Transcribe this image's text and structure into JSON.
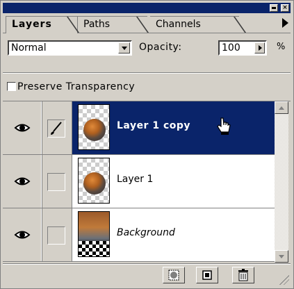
{
  "window": {
    "minimize_label": "",
    "close_label": "×"
  },
  "tabs": [
    {
      "label": "Layers",
      "active": true
    },
    {
      "label": "Paths",
      "active": false
    },
    {
      "label": "Channels",
      "active": false
    }
  ],
  "blend_mode": {
    "value": "Normal"
  },
  "opacity": {
    "label": "Opacity:",
    "value": "100",
    "unit": "%"
  },
  "preserve_transparency": {
    "label": "Preserve Transparency",
    "checked": false
  },
  "layers": [
    {
      "name": "Layer 1 copy",
      "visible": true,
      "brush": true,
      "selected": true,
      "italic": false
    },
    {
      "name": "Layer 1",
      "visible": true,
      "brush": false,
      "selected": false,
      "italic": false
    },
    {
      "name": "Background",
      "visible": true,
      "brush": false,
      "selected": false,
      "italic": true
    }
  ],
  "icons": {
    "eye": "eye-icon",
    "brush": "brush-icon",
    "cursor": "hand-cursor-icon",
    "mask": "add-mask-icon",
    "new": "new-layer-icon",
    "trash": "trash-icon",
    "menu": "palette-menu-arrow-icon"
  },
  "colors": {
    "selection": "#0a246a",
    "panel": "#d4d0c8"
  }
}
